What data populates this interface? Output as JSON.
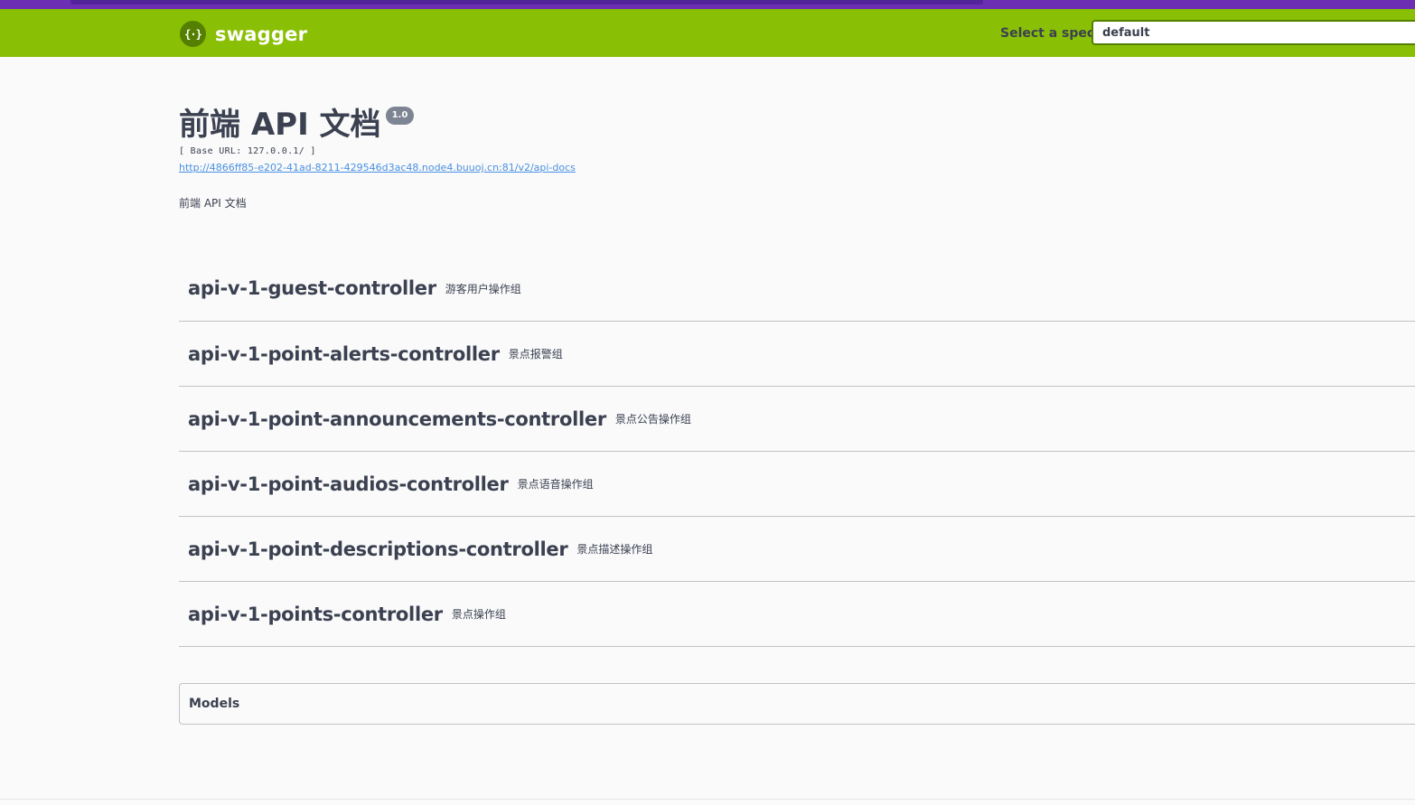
{
  "header": {
    "brand": "swagger",
    "brand_icon": "swagger-braces-icon",
    "spec_label": "Select a spec",
    "spec_selected": "default"
  },
  "info": {
    "title": "前端 API 文档",
    "version": "1.0",
    "base_url": "[ Base URL: 127.0.0.1/ ]",
    "docs_url": "http://4866ff85-e202-41ad-8211-429546d3ac48.node4.buuoj.cn:81/v2/api-docs",
    "description": "前端 API 文档"
  },
  "tags": [
    {
      "name": "api-v-1-guest-controller",
      "desc": "游客用户操作组"
    },
    {
      "name": "api-v-1-point-alerts-controller",
      "desc": "景点报警组"
    },
    {
      "name": "api-v-1-point-announcements-controller",
      "desc": "景点公告操作组"
    },
    {
      "name": "api-v-1-point-audios-controller",
      "desc": "景点语音操作组"
    },
    {
      "name": "api-v-1-point-descriptions-controller",
      "desc": "景点描述操作组"
    },
    {
      "name": "api-v-1-points-controller",
      "desc": "景点操作组"
    }
  ],
  "models": {
    "title": "Models"
  },
  "colors": {
    "topbar": "#89bf04",
    "text": "#3b4151",
    "link": "#4990e2",
    "browser_chrome": "#6c2fb4"
  }
}
